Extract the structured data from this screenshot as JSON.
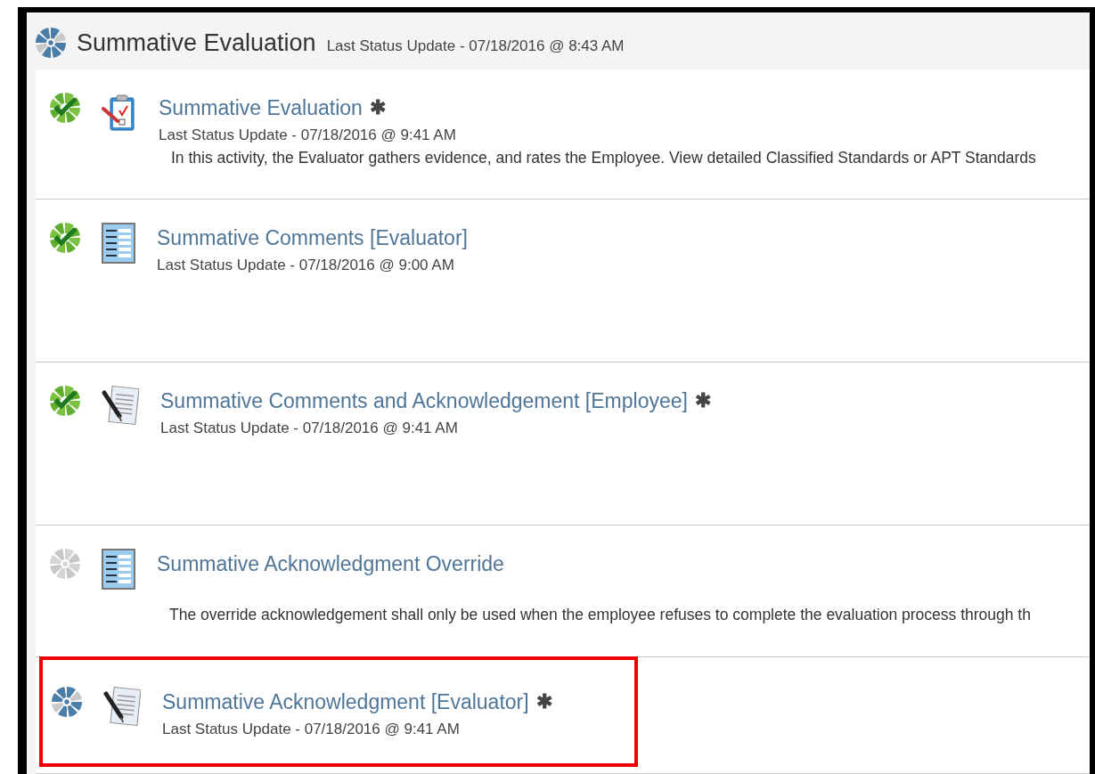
{
  "header": {
    "title": "Summative Evaluation",
    "status": "Last Status Update - 07/18/2016 @ 8:43 AM"
  },
  "activities": [
    {
      "title": "Summative Evaluation",
      "marker": "✱",
      "kind": "complete",
      "doc": {
        "kind": "clipboard"
      },
      "highlighted": false,
      "update": "Last Status Update - 07/18/2016 @ 9:41 AM",
      "description": "In this activity, the Evaluator gathers evidence, and rates the Employee. View detailed Classified Standards or APT Standards"
    },
    {
      "title": "Summative Comments [Evaluator]",
      "kind": "complete",
      "doc": {
        "kind": "form"
      },
      "highlighted": false,
      "update": "Last Status Update - 07/18/2016 @ 9:00 AM"
    },
    {
      "title": "Summative Comments and Acknowledgement [Employee]",
      "marker": "✱",
      "kind": "complete",
      "doc": {
        "kind": "signature"
      },
      "highlighted": false,
      "update": "Last Status Update - 07/18/2016 @ 9:41 AM"
    },
    {
      "title": "Summative Acknowledgment Override",
      "kind": "pending",
      "doc": {
        "kind": "form"
      },
      "highlighted": false,
      "description": "The override acknowledgement shall only be used when the employee refuses to complete the evaluation process through th"
    },
    {
      "title": "Summative Acknowledgment [Evaluator]",
      "marker": "✱",
      "kind": "current",
      "doc": {
        "kind": "signature"
      },
      "highlighted": true,
      "update": "Last Status Update - 07/18/2016 @ 9:41 AM"
    }
  ]
}
